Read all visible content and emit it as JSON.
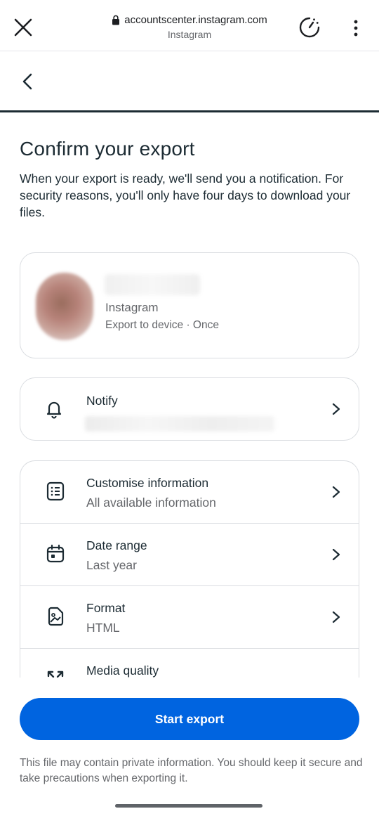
{
  "browser": {
    "url": "accountscenter.instagram.com",
    "site_name": "Instagram"
  },
  "page": {
    "title": "Confirm your export",
    "intro": "When your export is ready, we'll send you a notification. For security reasons, you'll only have four days to download your files."
  },
  "account_card": {
    "app": "Instagram",
    "details": "Export to device · Once"
  },
  "notify": {
    "title": "Notify"
  },
  "settings": [
    {
      "title": "Customise information",
      "value": "All available information",
      "icon": "list-document-icon"
    },
    {
      "title": "Date range",
      "value": "Last year",
      "icon": "calendar-icon"
    },
    {
      "title": "Format",
      "value": "HTML",
      "icon": "image-file-icon"
    },
    {
      "title": "Media quality",
      "value": "",
      "icon": "resize-icon"
    }
  ],
  "actions": {
    "start_export": "Start export"
  },
  "footer": {
    "note": "This file may contain private information. You should keep it secure and take precautions when exporting it."
  },
  "colors": {
    "primary_button": "#0064e0",
    "text_primary": "#1c2b33",
    "text_secondary": "#65676b",
    "border": "#dadde1"
  }
}
